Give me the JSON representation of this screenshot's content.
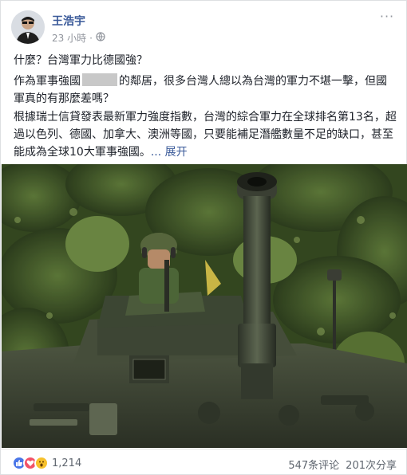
{
  "post": {
    "author": "王浩宇",
    "timestamp": "23 小時",
    "privacy_icon": "globe-icon",
    "more_label": "···",
    "line1": "什麼？台灣軍力比德國強？",
    "line2_a": "作為軍事強國",
    "line2_b": "的鄰居，很多台灣人總以為台灣的軍力不堪一擊，但國軍真的有那麼差嗎？",
    "line3": "根據瑞士信貸發表最新軍力強度指數，台灣的綜合軍力在全球排名第13名，超過以色列、德國、加拿大、澳洲等國，只要能補足潛艦數量不足的缺口，甚至能成為全球10大軍事強國。",
    "see_more": "... 展开"
  },
  "footer": {
    "reaction_icons": [
      "like-icon",
      "love-icon",
      "wow-icon"
    ],
    "reaction_count": "1,214",
    "comments": "547条评论",
    "shares": "201次分享"
  },
  "colors": {
    "link": "#385898",
    "text": "#1d2129",
    "meta": "#90949c",
    "like": "#4a76e8",
    "love": "#f25268",
    "wow": "#f7c12c"
  }
}
